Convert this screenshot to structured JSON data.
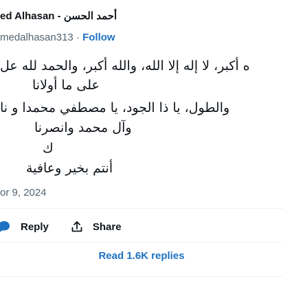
{
  "author": {
    "name": "ed Alhasan",
    "name_arabic": "أحمد الحسن",
    "separator": "-",
    "handle": "medalhasan313",
    "follow_label": "Follow",
    "dot": "·"
  },
  "tweet": {
    "lines": [
      "ه أكبر، لا إله إلا الله، والله أكبر، والحمد لله عل",
      "على ما أولانا",
      "والطول، يا ذا الجود، يا مصطفي محمدا و نا",
      "وآل محمد وانصرنا",
      "ك",
      "أنتم بخير وعافية"
    ]
  },
  "date": "or 9, 2024",
  "actions": {
    "reply_label": "Reply",
    "share_label": "Share"
  },
  "read_replies_label": "Read 1.6K replies",
  "colors": {
    "accent": "#1d72c2",
    "text": "#0f1419",
    "muted": "#536471",
    "divider": "#eff3f4"
  }
}
